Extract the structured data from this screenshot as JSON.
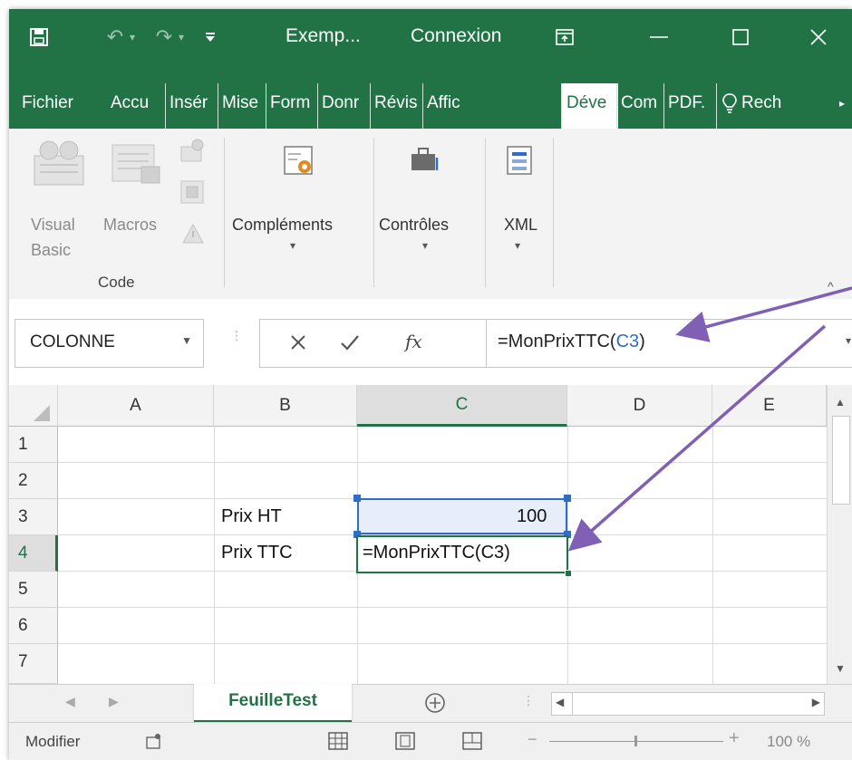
{
  "titlebar": {
    "save_icon": "save-icon",
    "title": "Exemp...",
    "account": "Connexion",
    "customize": "▾"
  },
  "tabs": [
    {
      "label": "Fichier"
    },
    {
      "label": "Accu"
    },
    {
      "label": "Insér"
    },
    {
      "label": "Mise"
    },
    {
      "label": "Form"
    },
    {
      "label": "Donr"
    },
    {
      "label": "Révis"
    },
    {
      "label": "Affic"
    },
    {
      "label": "Déve"
    },
    {
      "label": "Com"
    },
    {
      "label": "PDF."
    },
    {
      "label": "Rech"
    }
  ],
  "ribbon": {
    "visual_basic": "Visual",
    "visual_basic_2": "Basic",
    "macros": "Macros",
    "group_code": "Code",
    "complements": "Compléments",
    "controles": "Contrôles",
    "xml": "XML"
  },
  "formula_bar": {
    "name_box": "COLONNE",
    "fx": "fx",
    "formula_prefix": "=MonPrixTTC(",
    "formula_ref": "C3",
    "formula_suffix": ")"
  },
  "grid": {
    "columns": [
      "A",
      "B",
      "C",
      "D",
      "E"
    ],
    "rows": [
      "1",
      "2",
      "3",
      "4",
      "5",
      "6",
      "7"
    ],
    "cells": {
      "B3": "Prix HT",
      "C3": "100",
      "B4": "Prix TTC",
      "C4": "=MonPrixTTC(C3)"
    }
  },
  "sheets": {
    "active": "FeuilleTest"
  },
  "status": {
    "mode": "Modifier",
    "zoom": "100 %"
  },
  "colors": {
    "accent": "#217346",
    "annotation": "#7f60b5",
    "reference": "#2f6ec7"
  }
}
